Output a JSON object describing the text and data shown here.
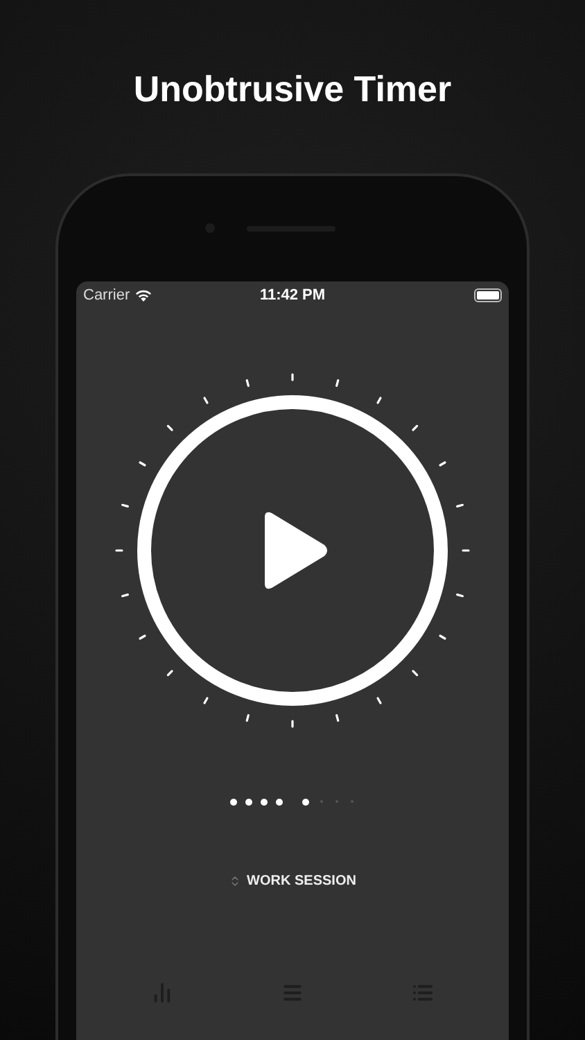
{
  "headline": "Unobtrusive Timer",
  "status_bar": {
    "carrier": "Carrier",
    "time": "11:42 PM"
  },
  "timer": {
    "running": false
  },
  "session_groups": [
    {
      "dots": [
        {
          "filled": true
        },
        {
          "filled": true
        },
        {
          "filled": true
        },
        {
          "filled": true
        }
      ]
    },
    {
      "dots": [
        {
          "filled": true
        },
        {
          "filled": false
        },
        {
          "filled": false
        },
        {
          "filled": false
        }
      ]
    }
  ],
  "session_label": "WORK SESSION",
  "tabs": [
    {
      "kind": "stats",
      "selected": false
    },
    {
      "kind": "menu",
      "selected": false
    },
    {
      "kind": "list",
      "selected": false
    }
  ]
}
